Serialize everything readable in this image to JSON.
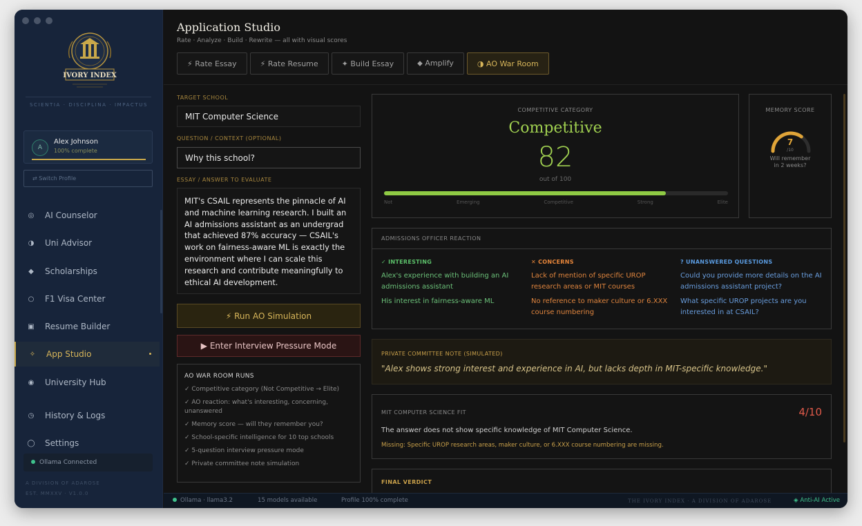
{
  "sidebar": {
    "motto": "SCIENTIA · DISCIPLINA · IMPACTUS",
    "logo_text": "IVORY INDEX",
    "profile": {
      "avatar": "A",
      "name": "Alex Johnson",
      "completion": "100% complete",
      "completion_pct": 100
    },
    "switch_profile": "⇄  Switch Profile",
    "nav": [
      {
        "label": "AI Counselor",
        "icon": "counselor-icon"
      },
      {
        "label": "Uni Advisor",
        "icon": "half-circle-icon"
      },
      {
        "label": "Scholarships",
        "icon": "diamond-icon"
      },
      {
        "label": "F1 Visa Center",
        "icon": "circle-icon"
      },
      {
        "label": "Resume Builder",
        "icon": "square-icon"
      },
      {
        "label": "App Studio",
        "icon": "sparkle-icon",
        "active": true
      },
      {
        "label": "University Hub",
        "icon": "dot-circle-icon"
      },
      {
        "label": "History & Logs",
        "icon": "clock-icon"
      },
      {
        "label": "Settings",
        "icon": "gear-icon"
      }
    ],
    "ollama_status": "Ollama Connected",
    "division": "A DIVISION OF ADAROSE",
    "est": "EST. MMXXV · V1.0.0"
  },
  "header": {
    "title": "Application Studio",
    "subtitle": "Rate · Analyze · Build · Rewrite — all with visual scores"
  },
  "tabs": [
    {
      "label": "⚡ Rate Essay"
    },
    {
      "label": "⚡ Rate Resume"
    },
    {
      "label": "✦ Build Essay"
    },
    {
      "label": "⬥ Amplify"
    },
    {
      "label": "◑ AO War Room",
      "active": true
    }
  ],
  "form": {
    "target_label": "TARGET SCHOOL",
    "target_value": "MIT Computer Science",
    "question_label": "QUESTION / CONTEXT (OPTIONAL)",
    "question_value": "Why this school?",
    "essay_label": "ESSAY / ANSWER TO EVALUATE",
    "essay_value": "MIT's CSAIL represents the pinnacle of AI and machine learning research. I built an AI admissions assistant as an undergrad that achieved 87% accuracy — CSAIL's work on fairness-aware ML is exactly the environment where I can scale this research and contribute meaningfully to ethical AI development.",
    "run_button": "⚡ Run AO Simulation",
    "interview_button": "▶ Enter Interview Pressure Mode"
  },
  "war_room": {
    "title": "AO WAR ROOM RUNS",
    "items": [
      "✓ Competitive category (Not Competitive → Elite)",
      "✓ AO reaction: what's interesting, concerning, unanswered",
      "✓ Memory score — will they remember you?",
      "✓ School-specific intelligence for 10 top schools",
      "✓ 5-question interview pressure mode",
      "✓ Private committee note simulation"
    ]
  },
  "competitive": {
    "label": "COMPETITIVE CATEGORY",
    "category": "Competitive",
    "score": "82",
    "score_value": 82,
    "out_of": "out of 100",
    "ticks": [
      "Not",
      "Emerging",
      "Competitive",
      "Strong",
      "Elite"
    ],
    "color": "#a0d050"
  },
  "memory": {
    "label": "MEMORY SCORE",
    "value": "7",
    "value_num": 7,
    "max": 10,
    "unit": "/10",
    "caption1": "Will remember",
    "caption2": "in 2 weeks?",
    "color": "#e0a438"
  },
  "ao_reaction": {
    "title": "ADMISSIONS OFFICER REACTION",
    "interesting": {
      "heading": "✓ INTERESTING",
      "items": [
        "Alex's experience with building an AI admissions assistant",
        "His interest in fairness-aware ML"
      ]
    },
    "concerns": {
      "heading": "✕ CONCERNS",
      "items": [
        "Lack of mention of specific UROP research areas or MIT courses",
        "No reference to maker culture or 6.XXX course numbering"
      ]
    },
    "unanswered": {
      "heading": "? UNANSWERED QUESTIONS",
      "items": [
        "Could you provide more details on the AI admissions assistant project?",
        "What specific UROP projects are you interested in at CSAIL?"
      ]
    }
  },
  "committee_note": {
    "label": "PRIVATE COMMITTEE NOTE (SIMULATED)",
    "text": "\"Alex shows strong interest and experience in AI, but lacks depth in MIT-specific knowledge.\""
  },
  "fit": {
    "label": "MIT COMPUTER SCIENCE FIT",
    "score": "4/10",
    "text": "The answer does not show specific knowledge of MIT Computer Science.",
    "missing": "Missing: Specific UROP research areas, maker culture, or 6.XXX course numbering are missing."
  },
  "verdict": {
    "label": "FINAL VERDICT"
  },
  "statusbar": {
    "model": "Ollama · llama3.2",
    "models_available": "15 models available",
    "profile": "Profile 100% complete",
    "brand": "THE IVORY INDEX · A DIVISION OF ADAROSE",
    "anti_ai": "◈ Anti-AI Active"
  }
}
